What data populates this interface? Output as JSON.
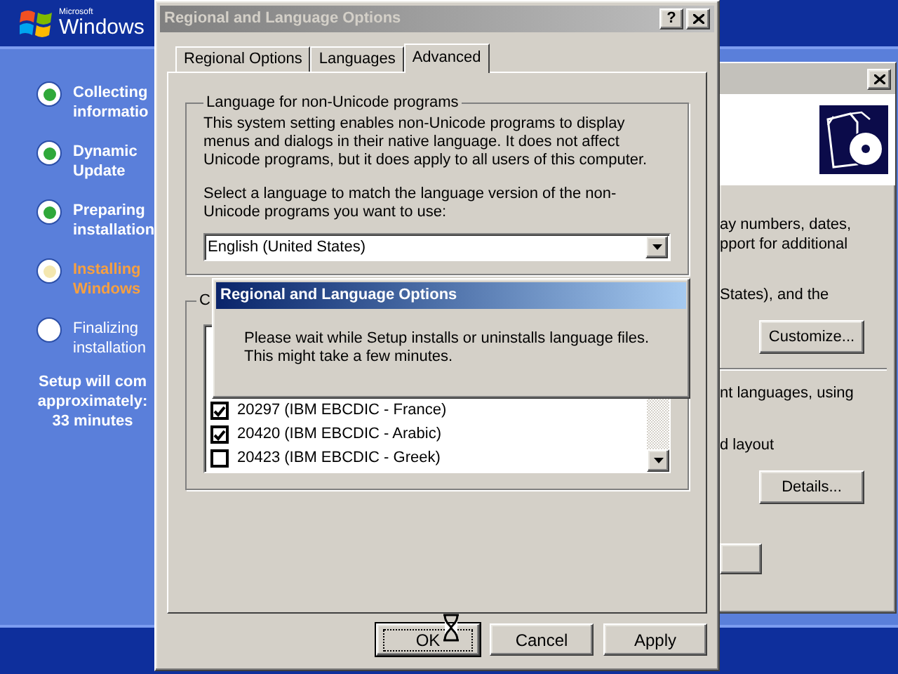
{
  "setup": {
    "logo": {
      "maker": "Microsoft",
      "brand": "Windows"
    },
    "steps": [
      {
        "lines": [
          "Collecting",
          "informatio"
        ],
        "completed": true,
        "current": false
      },
      {
        "lines": [
          "Dynamic",
          "Update"
        ],
        "completed": true,
        "current": false
      },
      {
        "lines": [
          "Preparing",
          "installation"
        ],
        "completed": true,
        "current": false
      },
      {
        "lines": [
          "Installing",
          "Windows"
        ],
        "completed": false,
        "current": true
      },
      {
        "lines": [
          "Finalizing",
          "installation"
        ],
        "completed": false,
        "current": false
      }
    ],
    "time_estimate": [
      "Setup will com",
      "approximately:",
      "33 minutes"
    ]
  },
  "back_window": {
    "paragraphs_top": [
      [
        "ay numbers, dates,",
        "pport for additional"
      ],
      [
        "States), and the"
      ]
    ],
    "customize_button": "Customize...",
    "paragraphs_bottom": [
      [
        "nt languages, using"
      ],
      [
        "d layout"
      ]
    ],
    "details_button": "Details..."
  },
  "dialog": {
    "title": "Regional and Language Options",
    "active": false,
    "help_button": "?",
    "tabs": [
      {
        "label": "Regional Options",
        "selected": false
      },
      {
        "label": "Languages",
        "selected": false
      },
      {
        "label": "Advanced",
        "selected": true
      }
    ],
    "group_1": {
      "legend": "Language for non-Unicode programs",
      "description": "This system setting enables non-Unicode programs to display menus and dialogs in their native language. It does not affect Unicode programs, but it does apply to all users of this computer.",
      "prompt": "Select a language to match the language version of the non-Unicode programs you want to use:",
      "dropdown": {
        "value": "English (United States)"
      }
    },
    "group_2": {
      "legend": "C",
      "code_pages": [
        {
          "label": "20297 (IBM EBCDIC - France)",
          "checked": true
        },
        {
          "label": "20420 (IBM EBCDIC - Arabic)",
          "checked": true
        },
        {
          "label": "20423 (IBM EBCDIC - Greek)",
          "checked": false
        }
      ]
    },
    "buttons": [
      {
        "label": "OK",
        "focused": true
      },
      {
        "label": "Cancel",
        "focused": false
      },
      {
        "label": "Apply",
        "focused": false
      }
    ]
  },
  "progress_popup": {
    "title": "Regional and Language Options",
    "active": true,
    "message": "Please wait while Setup installs or uninstalls language files. This might take a few minutes."
  }
}
